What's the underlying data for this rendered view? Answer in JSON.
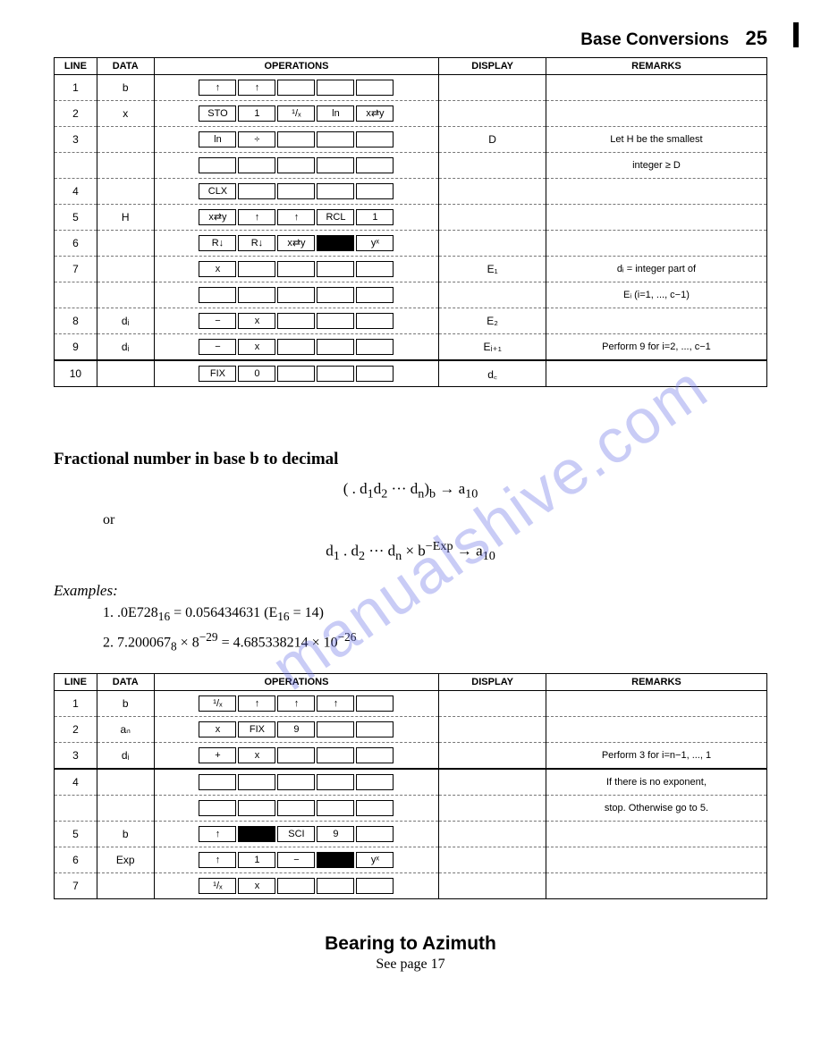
{
  "header": {
    "title": "Base Conversions",
    "page_number": "25"
  },
  "table1": {
    "headers": {
      "line": "LINE",
      "data": "DATA",
      "operations": "OPERATIONS",
      "display": "DISPLAY",
      "remarks": "REMARKS"
    },
    "rows": [
      {
        "line": "1",
        "data": "b",
        "ops": [
          {
            "t": "↑"
          },
          {
            "t": "↑"
          },
          {
            "t": ""
          },
          {
            "t": ""
          },
          {
            "t": ""
          }
        ],
        "display": "",
        "remarks": ""
      },
      {
        "line": "2",
        "data": "x",
        "ops": [
          {
            "t": "STO"
          },
          {
            "t": "1"
          },
          {
            "t": "¹/ₓ"
          },
          {
            "t": "ln"
          },
          {
            "t": "x⇄y"
          }
        ],
        "display": "",
        "remarks": ""
      },
      {
        "line": "3",
        "data": "",
        "ops": [
          {
            "t": "ln"
          },
          {
            "t": "÷"
          },
          {
            "t": ""
          },
          {
            "t": ""
          },
          {
            "t": ""
          }
        ],
        "display": "D",
        "remarks": "Let H be the smallest"
      },
      {
        "line": "",
        "data": "",
        "ops": [
          {
            "t": ""
          },
          {
            "t": ""
          },
          {
            "t": ""
          },
          {
            "t": ""
          },
          {
            "t": ""
          }
        ],
        "display": "",
        "remarks": "integer ≥ D"
      },
      {
        "line": "4",
        "data": "",
        "ops": [
          {
            "t": "CLX"
          },
          {
            "t": ""
          },
          {
            "t": ""
          },
          {
            "t": ""
          },
          {
            "t": ""
          }
        ],
        "display": "",
        "remarks": ""
      },
      {
        "line": "5",
        "data": "H",
        "ops": [
          {
            "t": "x⇄y"
          },
          {
            "t": "↑"
          },
          {
            "t": "↑"
          },
          {
            "t": "RCL"
          },
          {
            "t": "1"
          }
        ],
        "display": "",
        "remarks": ""
      },
      {
        "line": "6",
        "data": "",
        "ops": [
          {
            "t": "R↓"
          },
          {
            "t": "R↓"
          },
          {
            "t": "x⇄y"
          },
          {
            "t": "",
            "solid": true
          },
          {
            "t": "yˣ"
          }
        ],
        "display": "",
        "remarks": ""
      },
      {
        "line": "7",
        "data": "",
        "ops": [
          {
            "t": "x"
          },
          {
            "t": ""
          },
          {
            "t": ""
          },
          {
            "t": ""
          },
          {
            "t": ""
          }
        ],
        "display": "E₁",
        "remarks": "dᵢ = integer part of"
      },
      {
        "line": "",
        "data": "",
        "ops": [
          {
            "t": ""
          },
          {
            "t": ""
          },
          {
            "t": ""
          },
          {
            "t": ""
          },
          {
            "t": ""
          }
        ],
        "display": "",
        "remarks": "Eᵢ (i=1, ..., c−1)"
      },
      {
        "line": "8",
        "data": "dᵢ",
        "ops": [
          {
            "t": "−"
          },
          {
            "t": "x"
          },
          {
            "t": ""
          },
          {
            "t": ""
          },
          {
            "t": ""
          }
        ],
        "display": "E₂",
        "remarks": ""
      },
      {
        "line": "9",
        "data": "dᵢ",
        "ops": [
          {
            "t": "−"
          },
          {
            "t": "x"
          },
          {
            "t": ""
          },
          {
            "t": ""
          },
          {
            "t": ""
          }
        ],
        "display": "Eᵢ₊₁",
        "remarks": "Perform 9 for i=2, ..., c−1",
        "thick": true
      },
      {
        "line": "10",
        "data": "",
        "ops": [
          {
            "t": "FIX"
          },
          {
            "t": "0"
          },
          {
            "t": ""
          },
          {
            "t": ""
          },
          {
            "t": ""
          }
        ],
        "display": "d꜀",
        "remarks": "",
        "last": true
      }
    ]
  },
  "section1": {
    "heading": "Fractional number in base b to decimal",
    "formula1_html": "( . d<sub>1</sub>d<sub>2</sub> ··· d<sub>n</sub>)<sub>b</sub> → a<sub>10</sub>",
    "or": "or",
    "formula2_html": "d<sub>1</sub> . d<sub>2</sub> ··· d<sub>n</sub> × b<sup>−Exp</sup> → a<sub>10</sub>"
  },
  "examples": {
    "heading": "Examples:",
    "items": [
      "1.  .0E728<sub>16</sub> = 0.056434631 (E<sub>16</sub> = 14)",
      "2.  7.200067<sub>8</sub> × 8<sup>−29</sup> = 4.685338214 × 10<sup>−26</sup>"
    ]
  },
  "table2": {
    "headers": {
      "line": "LINE",
      "data": "DATA",
      "operations": "OPERATIONS",
      "display": "DISPLAY",
      "remarks": "REMARKS"
    },
    "rows": [
      {
        "line": "1",
        "data": "b",
        "ops": [
          {
            "t": "¹/ₓ"
          },
          {
            "t": "↑"
          },
          {
            "t": "↑"
          },
          {
            "t": "↑"
          },
          {
            "t": ""
          }
        ],
        "display": "",
        "remarks": ""
      },
      {
        "line": "2",
        "data": "aₙ",
        "ops": [
          {
            "t": "x"
          },
          {
            "t": "FIX"
          },
          {
            "t": "9"
          },
          {
            "t": ""
          },
          {
            "t": ""
          }
        ],
        "display": "",
        "remarks": ""
      },
      {
        "line": "3",
        "data": "dᵢ",
        "ops": [
          {
            "t": "+"
          },
          {
            "t": "x"
          },
          {
            "t": ""
          },
          {
            "t": ""
          },
          {
            "t": ""
          }
        ],
        "display": "",
        "remarks": "Perform 3 for i=n−1, ..., 1",
        "thick": true
      },
      {
        "line": "4",
        "data": "",
        "ops": [
          {
            "t": ""
          },
          {
            "t": ""
          },
          {
            "t": ""
          },
          {
            "t": ""
          },
          {
            "t": ""
          }
        ],
        "display": "",
        "remarks": "If there is no exponent,"
      },
      {
        "line": "",
        "data": "",
        "ops": [
          {
            "t": ""
          },
          {
            "t": ""
          },
          {
            "t": ""
          },
          {
            "t": ""
          },
          {
            "t": ""
          }
        ],
        "display": "",
        "remarks": "stop. Otherwise go to 5."
      },
      {
        "line": "5",
        "data": "b",
        "ops": [
          {
            "t": "↑"
          },
          {
            "t": "",
            "solid": true
          },
          {
            "t": "SCI"
          },
          {
            "t": "9"
          },
          {
            "t": ""
          }
        ],
        "display": "",
        "remarks": ""
      },
      {
        "line": "6",
        "data": "Exp",
        "ops": [
          {
            "t": "↑"
          },
          {
            "t": "1"
          },
          {
            "t": "−"
          },
          {
            "t": "",
            "solid": true
          },
          {
            "t": "yˣ"
          }
        ],
        "display": "",
        "remarks": ""
      },
      {
        "line": "7",
        "data": "",
        "ops": [
          {
            "t": "¹/ₓ"
          },
          {
            "t": "x"
          },
          {
            "t": ""
          },
          {
            "t": ""
          },
          {
            "t": ""
          }
        ],
        "display": "",
        "remarks": "",
        "last": true
      }
    ]
  },
  "footer": {
    "title": "Bearing to Azimuth",
    "sub": "See page 17"
  },
  "watermark": "manualshive.com"
}
